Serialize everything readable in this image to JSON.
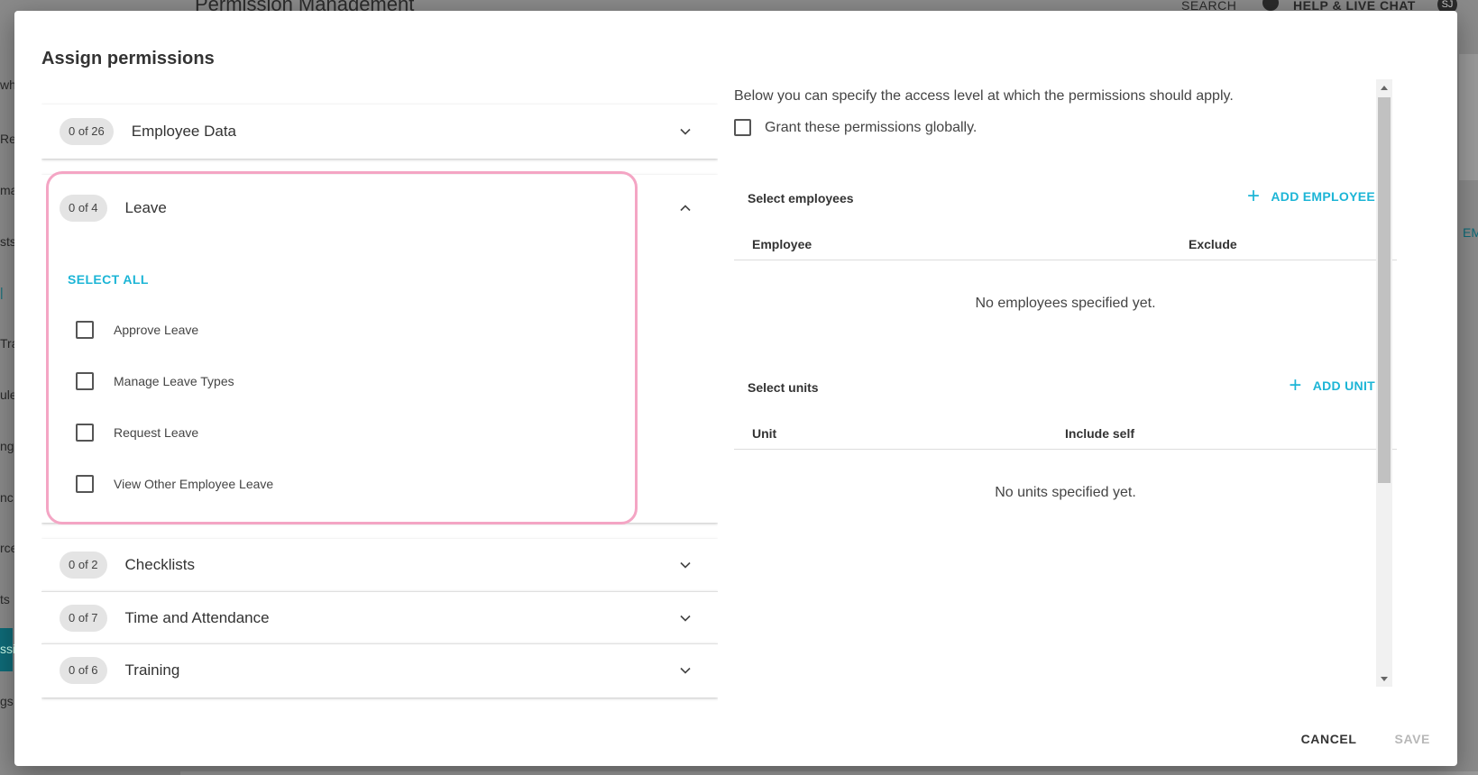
{
  "background": {
    "page_title": "Permission Management",
    "search_label": "SEARCH",
    "help_label": "HELP & LIVE CHAT",
    "avatar_initials": "SJ",
    "sidebar_fragments": [
      "wh",
      "Re",
      "ma",
      "sts",
      "|",
      "Tra",
      "ule",
      "ng",
      "nc",
      "rce",
      "ts",
      "ssi",
      "gs"
    ],
    "right_fragment": "EM"
  },
  "dialog": {
    "title": "Assign permissions",
    "categories": [
      {
        "count": "0 of 26",
        "label": "Employee Data",
        "expanded": false
      },
      {
        "count": "0 of 4",
        "label": "Leave",
        "expanded": true
      },
      {
        "count": "0 of 2",
        "label": "Checklists",
        "expanded": false
      },
      {
        "count": "0 of 7",
        "label": "Time and Attendance",
        "expanded": false
      },
      {
        "count": "0 of 6",
        "label": "Training",
        "expanded": false
      }
    ],
    "leave": {
      "select_all": "SELECT ALL",
      "permissions": [
        {
          "label": "Approve Leave",
          "checked": false
        },
        {
          "label": "Manage Leave Types",
          "checked": false
        },
        {
          "label": "Request Leave",
          "checked": false
        },
        {
          "label": "View Other Employee Leave",
          "checked": false
        }
      ]
    },
    "scope": {
      "intro": "Below you can specify the access level at which the permissions should apply.",
      "global_label": "Grant these permissions globally.",
      "global_checked": false,
      "employees": {
        "title": "Select employees",
        "add_label": "ADD EMPLOYEE",
        "columns": [
          "Employee",
          "Exclude"
        ],
        "empty": "No employees specified yet."
      },
      "units": {
        "title": "Select units",
        "add_label": "ADD UNIT",
        "columns": [
          "Unit",
          "Include self"
        ],
        "empty": "No units specified yet."
      }
    },
    "footer": {
      "cancel": "CANCEL",
      "save": "SAVE"
    }
  },
  "colors": {
    "accent": "#1cb5d6",
    "highlight": "#f4a5c4",
    "sidebar_active": "#0e6b78"
  }
}
